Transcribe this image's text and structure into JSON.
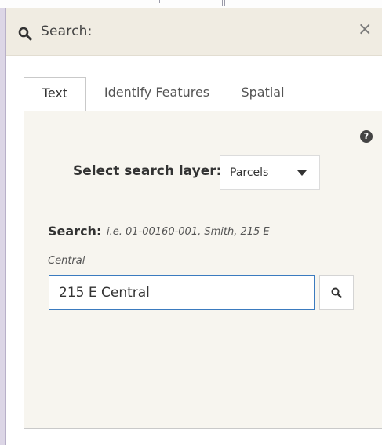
{
  "header": {
    "title": "Search:",
    "icon": "search-icon",
    "close_icon": "×"
  },
  "tabs": [
    {
      "label": "Text",
      "active": true
    },
    {
      "label": "Identify Features",
      "active": false
    },
    {
      "label": "Spatial",
      "active": false
    }
  ],
  "help_icon": "?",
  "layer": {
    "label": "Select search layer:",
    "value": "Parcels"
  },
  "search": {
    "label": "Search:",
    "hint_line1": "i.e. 01-00160-001, Smith, 215 E",
    "hint_line2": "Central",
    "value": "215 E Central",
    "button_icon": "search-icon"
  },
  "colors": {
    "header_bg": "#f0ece2",
    "content_bg": "#f7f5ef",
    "input_border": "#3b7bbf"
  }
}
